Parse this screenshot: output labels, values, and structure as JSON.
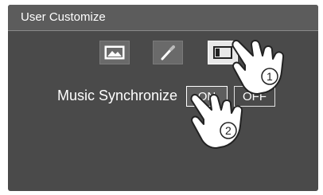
{
  "window": {
    "title": "User Customize"
  },
  "tabs": [
    {
      "icon": "wallpaper-icon",
      "active": false
    },
    {
      "icon": "color-picker-icon",
      "active": false
    },
    {
      "icon": "panel-icon",
      "active": true
    }
  ],
  "music_sync": {
    "label": "Music Synchronize",
    "options": [
      {
        "label": "ON",
        "selected": true
      },
      {
        "label": "OFF",
        "selected": false
      }
    ]
  },
  "steps": [
    {
      "number": "1",
      "icon": "pointing-hand-icon"
    },
    {
      "number": "2",
      "icon": "pointing-hand-icon"
    }
  ],
  "colors": {
    "screen_bg": "#4a4a4a",
    "title_bg": "#5c5c5c",
    "active_tab": "#e8e8e8",
    "text": "#ffffff"
  }
}
